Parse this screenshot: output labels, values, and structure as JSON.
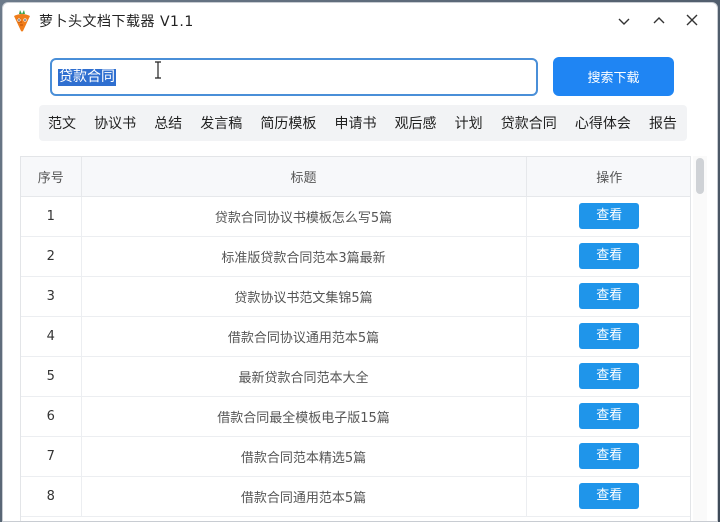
{
  "window": {
    "title": "萝卜头文档下载器  V1.1",
    "controls": {
      "minimize": "minimize-icon",
      "maximize": "maximize-icon",
      "close": "close-icon"
    }
  },
  "search": {
    "value": "贷款合同",
    "button_label": "搜索下载"
  },
  "categories": [
    "范文",
    "协议书",
    "总结",
    "发言稿",
    "简历模板",
    "申请书",
    "观后感",
    "计划",
    "贷款合同",
    "心得体会",
    "报告"
  ],
  "table": {
    "headers": {
      "index": "序号",
      "title": "标题",
      "action": "操作"
    },
    "rows": [
      {
        "index": "1",
        "title": "贷款合同协议书模板怎么写5篇",
        "action": "查看"
      },
      {
        "index": "2",
        "title": "标准版贷款合同范本3篇最新",
        "action": "查看"
      },
      {
        "index": "3",
        "title": "贷款协议书范文集锦5篇",
        "action": "查看"
      },
      {
        "index": "4",
        "title": "借款合同协议通用范本5篇",
        "action": "查看"
      },
      {
        "index": "5",
        "title": "最新贷款合同范本大全",
        "action": "查看"
      },
      {
        "index": "6",
        "title": "借款合同最全模板电子版15篇",
        "action": "查看"
      },
      {
        "index": "7",
        "title": "借款合同范本精选5篇",
        "action": "查看"
      },
      {
        "index": "8",
        "title": "借款合同通用范本5篇",
        "action": "查看"
      }
    ]
  },
  "colors": {
    "accent": "#1f85f3",
    "view_button": "#1f95ea",
    "selection": "#2f6fd0",
    "input_border": "#4a8fd8"
  }
}
